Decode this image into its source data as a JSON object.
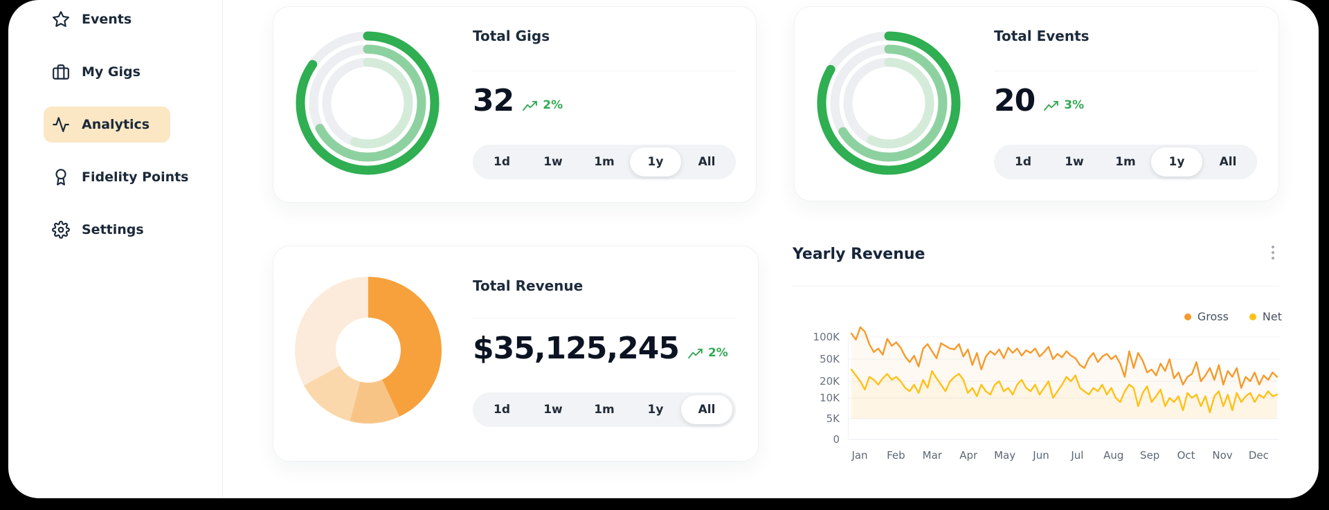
{
  "sidebar": {
    "items": [
      {
        "label": "Events",
        "icon": "star",
        "active": false
      },
      {
        "label": "My Gigs",
        "icon": "briefcase",
        "active": false
      },
      {
        "label": "Analytics",
        "icon": "activity",
        "active": true
      },
      {
        "label": "Fidelity Points",
        "icon": "award",
        "active": false
      },
      {
        "label": "Settings",
        "icon": "gear",
        "active": false
      }
    ],
    "active_bg": "#FBE7C4"
  },
  "cards": {
    "total_gigs": {
      "title": "Total Gigs",
      "value": "32",
      "trend": "2%",
      "filters": [
        "1d",
        "1w",
        "1m",
        "1y",
        "All"
      ],
      "selected_filter": "1y",
      "rings": {
        "track": "#ECEEF1",
        "arcs": [
          {
            "color": "#2FAE52",
            "deg": 305
          },
          {
            "color": "#8ED1A0",
            "deg": 242
          },
          {
            "color": "#D5EBDA",
            "deg": 198
          }
        ]
      }
    },
    "total_events": {
      "title": "Total Events",
      "value": "20",
      "trend": "3%",
      "filters": [
        "1d",
        "1w",
        "1m",
        "1y",
        "All"
      ],
      "selected_filter": "1y",
      "rings": {
        "track": "#ECEEF1",
        "arcs": [
          {
            "color": "#2FAE52",
            "deg": 300
          },
          {
            "color": "#8ED1A0",
            "deg": 238
          },
          {
            "color": "#D5EBDA",
            "deg": 205
          }
        ]
      }
    },
    "total_revenue": {
      "title": "Total Revenue",
      "value": "$35,125,245",
      "trend": "2%",
      "filters": [
        "1d",
        "1w",
        "1m",
        "1y",
        "All"
      ],
      "selected_filter": "All",
      "donut_segments": [
        {
          "color": "#F6A13C",
          "pct": 43
        },
        {
          "color": "#F8C486",
          "pct": 11
        },
        {
          "color": "#FAD8AB",
          "pct": 13
        },
        {
          "color": "#FCEBDA",
          "pct": 33
        }
      ]
    }
  },
  "chart": {
    "title": "Yearly Revenue",
    "legend": [
      {
        "label": "Gross",
        "color": "#F59A2B"
      },
      {
        "label": "Net",
        "color": "#FFC117"
      }
    ],
    "months": [
      "Jan",
      "Feb",
      "Mar",
      "Apr",
      "May",
      "Jun",
      "Jul",
      "Aug",
      "Sep",
      "Oct",
      "Nov",
      "Dec"
    ],
    "y_ticks": [
      {
        "label": "100K",
        "value": 100
      },
      {
        "label": "50K",
        "value": 50
      },
      {
        "label": "20K",
        "value": 20
      },
      {
        "label": "10K",
        "value": 10
      },
      {
        "label": "5K",
        "value": 5
      },
      {
        "label": "0",
        "value": 0
      }
    ]
  },
  "chart_data": {
    "type": "line",
    "title": "Yearly Revenue",
    "x_categories": [
      "Jan",
      "Feb",
      "Mar",
      "Apr",
      "May",
      "Jun",
      "Jul",
      "Aug",
      "Sep",
      "Oct",
      "Nov",
      "Dec"
    ],
    "points_per_month": 8,
    "y_unit": "K (thousands)",
    "y_axis": {
      "ticks": [
        100,
        50,
        20,
        10,
        5,
        0
      ],
      "scale": "log-like"
    },
    "grid": true,
    "legend_position": "top-right",
    "series": [
      {
        "name": "Gross",
        "color": "#F59A2B",
        "values": [
          108,
          94,
          122,
          112,
          84,
          66,
          74,
          60,
          96,
          80,
          88,
          76,
          56,
          46,
          58,
          40,
          74,
          84,
          68,
          52,
          86,
          80,
          74,
          72,
          84,
          56,
          72,
          42,
          64,
          36,
          56,
          68,
          60,
          72,
          52,
          76,
          64,
          74,
          58,
          70,
          64,
          74,
          56,
          66,
          78,
          50,
          62,
          54,
          68,
          58,
          52,
          42,
          38,
          52,
          64,
          46,
          56,
          62,
          50,
          58,
          44,
          26,
          68,
          38,
          64,
          48,
          32,
          36,
          28,
          44,
          34,
          50,
          24,
          32,
          18,
          26,
          30,
          46,
          20,
          28,
          38,
          22,
          42,
          18,
          34,
          26,
          38,
          16,
          26,
          20,
          32,
          18,
          28,
          22,
          32,
          26
        ]
      },
      {
        "name": "Net",
        "color": "#FFC117",
        "values": [
          36,
          28,
          20,
          15,
          26,
          22,
          18,
          24,
          30,
          22,
          26,
          20,
          16,
          14,
          18,
          13,
          22,
          16,
          34,
          24,
          18,
          14,
          20,
          26,
          30,
          22,
          13,
          16,
          11,
          18,
          14,
          12,
          18,
          20,
          14,
          16,
          12,
          18,
          22,
          16,
          14,
          18,
          12,
          16,
          20,
          10,
          14,
          18,
          26,
          20,
          28,
          16,
          14,
          12,
          16,
          14,
          18,
          12,
          16,
          10,
          9,
          14,
          18,
          16,
          8,
          13,
          17,
          9,
          11,
          15,
          8,
          10,
          9,
          11,
          7,
          13,
          10,
          12,
          8,
          11,
          6.5,
          11,
          14,
          8,
          12,
          7,
          13,
          9,
          11,
          13,
          9,
          12,
          10,
          14,
          11,
          12
        ]
      }
    ]
  }
}
